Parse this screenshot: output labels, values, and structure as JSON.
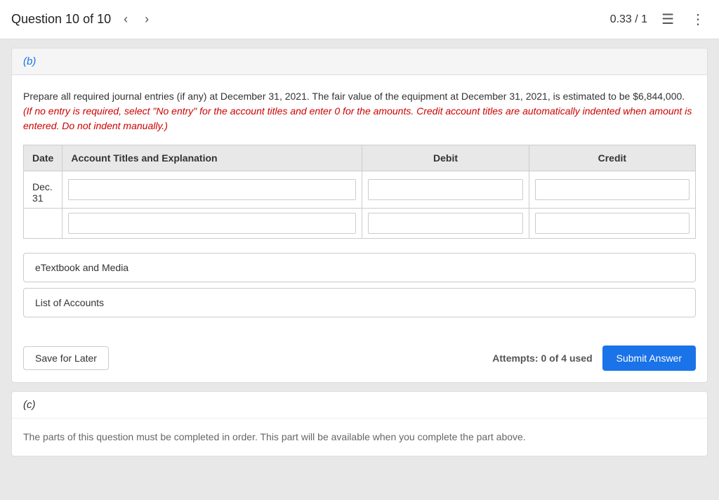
{
  "header": {
    "question_title": "Question 10 of 10",
    "score": "0.33 / 1",
    "prev_arrow": "‹",
    "next_arrow": "›",
    "list_icon": "☰",
    "more_icon": "⋮"
  },
  "part_b": {
    "label": "(b)",
    "question_text": "Prepare all required journal entries (if any) at December 31, 2021. The fair value of the equipment at December 31, 2021, is estimated to be $6,844,000.",
    "instruction": "(If no entry is required, select \"No entry\" for the account titles and enter 0 for the amounts. Credit account titles are automatically indented when amount is entered. Do not indent manually.)",
    "table": {
      "headers": [
        "Date",
        "Account Titles and Explanation",
        "Debit",
        "Credit"
      ],
      "rows": [
        {
          "date": "Dec. 31",
          "account": "",
          "debit": "",
          "credit": ""
        },
        {
          "date": "",
          "account": "",
          "debit": "",
          "credit": ""
        }
      ]
    },
    "etextbook_label": "eTextbook and Media",
    "list_accounts_label": "List of Accounts",
    "save_later_label": "Save for Later",
    "attempts_label": "Attempts: 0 of 4 used",
    "submit_label": "Submit Answer"
  },
  "part_c": {
    "label": "(c)",
    "availability_text": "The parts of this question must be completed in order. This part will be available when you complete the part above."
  }
}
